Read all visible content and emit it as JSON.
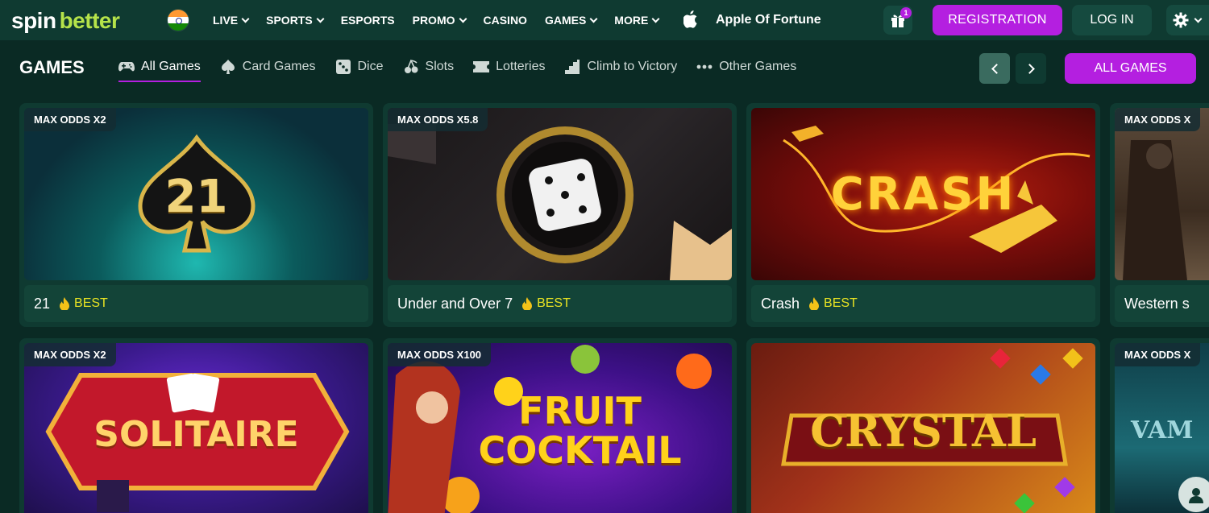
{
  "header": {
    "logo_spin": "spin",
    "logo_better": "better",
    "country_flag": "india-flag",
    "nav": [
      {
        "label": "LIVE",
        "dropdown": true
      },
      {
        "label": "SPORTS",
        "dropdown": true
      },
      {
        "label": "ESPORTS",
        "dropdown": false
      },
      {
        "label": "PROMO",
        "dropdown": true
      },
      {
        "label": "CASINO",
        "dropdown": false
      },
      {
        "label": "GAMES",
        "dropdown": true
      },
      {
        "label": "MORE",
        "dropdown": true
      }
    ],
    "app_title": "Apple Of Fortune",
    "gift_count": "1",
    "register_label": "REGISTRATION",
    "login_label": "LOG IN"
  },
  "games_bar": {
    "title": "GAMES",
    "tabs": [
      {
        "label": "All Games",
        "icon": "gamepad-icon",
        "active": true
      },
      {
        "label": "Card Games",
        "icon": "spade-icon",
        "active": false
      },
      {
        "label": "Dice",
        "icon": "dice-icon",
        "active": false
      },
      {
        "label": "Slots",
        "icon": "cherry-icon",
        "active": false
      },
      {
        "label": "Lotteries",
        "icon": "ticket-icon",
        "active": false
      },
      {
        "label": "Climb to Victory",
        "icon": "stairs-icon",
        "active": false
      },
      {
        "label": "Other Games",
        "icon": "dots-icon",
        "active": false
      }
    ],
    "all_games_label": "ALL GAMES"
  },
  "cards_row1": [
    {
      "odds": "MAX ODDS X2",
      "name": "21",
      "badge": "BEST",
      "art": "21"
    },
    {
      "odds": "MAX ODDS X5.8",
      "name": "Under and Over 7",
      "badge": "BEST",
      "art": ""
    },
    {
      "odds": "",
      "name": "Crash",
      "badge": "BEST",
      "art": "CRASH"
    },
    {
      "odds": "MAX ODDS X",
      "name": "Western s",
      "badge": "",
      "art": ""
    }
  ],
  "cards_row2": [
    {
      "odds": "MAX ODDS X2",
      "art": "SOLITAIRE"
    },
    {
      "odds": "MAX ODDS X100",
      "art": "FRUIT COCKTAIL"
    },
    {
      "odds": "",
      "art": "CRYSTAL"
    },
    {
      "odds": "MAX ODDS X",
      "art": "VAM"
    }
  ],
  "colors": {
    "accent": "#b41fe0",
    "background": "#0a2a24",
    "header": "#0f3a31",
    "best": "#e8e323",
    "logo_green": "#b6e34a"
  }
}
